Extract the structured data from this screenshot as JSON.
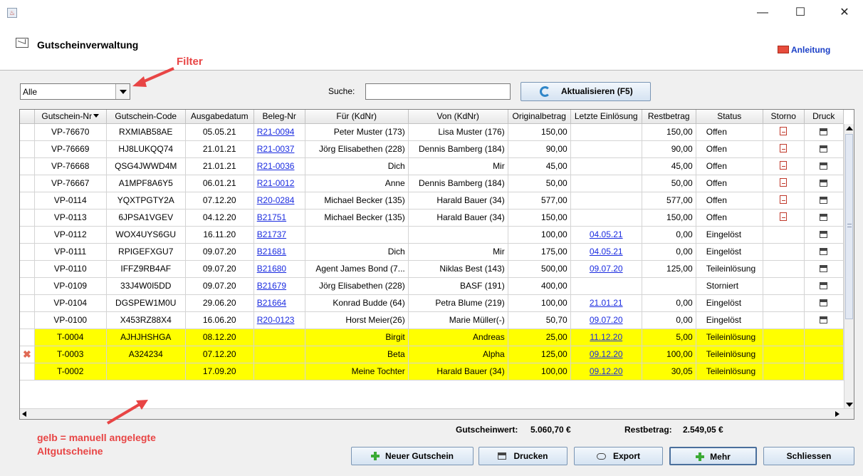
{
  "window": {
    "minimize": "—",
    "maximize": "☐",
    "close": "✕"
  },
  "header": {
    "title": "Gutscheinverwaltung",
    "guide_link": "Anleitung"
  },
  "annotations": {
    "filter": "Filter",
    "yellow_note_1": "gelb = manuell angelegte",
    "yellow_note_2": "Altgutscheine"
  },
  "toolbar": {
    "filter_value": "Alle",
    "search_label": "Suche:",
    "search_value": "",
    "refresh_label": "Aktualisieren (F5)"
  },
  "table": {
    "columns": [
      "Gutschein-Nr",
      "Gutschein-Code",
      "Ausgabedatum",
      "Beleg-Nr",
      "Für (KdNr)",
      "Von (KdNr)",
      "Originalbetrag",
      "Letzte Einlösung",
      "Restbetrag",
      "Status",
      "Storno",
      "Druck"
    ],
    "rows": [
      {
        "nr": "VP-76670",
        "code": "RXMIAB58AE",
        "datum": "05.05.21",
        "beleg": "R21-0094",
        "fuer": "Peter Muster (173)",
        "von": "Lisa Muster (176)",
        "orig": "150,00",
        "einl": "",
        "rest": "150,00",
        "status": "Offen",
        "storno": true,
        "druck": true,
        "manual": false,
        "mark": false
      },
      {
        "nr": "VP-76669",
        "code": "HJ8LUKQQ74",
        "datum": "21.01.21",
        "beleg": "R21-0037",
        "fuer": "Jörg Elisabethen (228)",
        "von": "Dennis Bamberg (184)",
        "orig": "90,00",
        "einl": "",
        "rest": "90,00",
        "status": "Offen",
        "storno": true,
        "druck": true,
        "manual": false,
        "mark": false
      },
      {
        "nr": "VP-76668",
        "code": "QSG4JWWD4M",
        "datum": "21.01.21",
        "beleg": "R21-0036",
        "fuer": "Dich",
        "von": "Mir",
        "orig": "45,00",
        "einl": "",
        "rest": "45,00",
        "status": "Offen",
        "storno": true,
        "druck": true,
        "manual": false,
        "mark": false
      },
      {
        "nr": "VP-76667",
        "code": "A1MPF8A6Y5",
        "datum": "06.01.21",
        "beleg": "R21-0012",
        "fuer": "Anne",
        "von": "Dennis Bamberg (184)",
        "orig": "50,00",
        "einl": "",
        "rest": "50,00",
        "status": "Offen",
        "storno": true,
        "druck": true,
        "manual": false,
        "mark": false
      },
      {
        "nr": "VP-0114",
        "code": "YQXTPGTY2A",
        "datum": "07.12.20",
        "beleg": "R20-0284",
        "fuer": "Michael Becker (135)",
        "von": "Harald Bauer (34)",
        "orig": "577,00",
        "einl": "",
        "rest": "577,00",
        "status": "Offen",
        "storno": true,
        "druck": true,
        "manual": false,
        "mark": false
      },
      {
        "nr": "VP-0113",
        "code": "6JPSA1VGEV",
        "datum": "04.12.20",
        "beleg": "B21751",
        "fuer": "Michael Becker (135)",
        "von": "Harald Bauer (34)",
        "orig": "150,00",
        "einl": "",
        "rest": "150,00",
        "status": "Offen",
        "storno": true,
        "druck": true,
        "manual": false,
        "mark": false
      },
      {
        "nr": "VP-0112",
        "code": "WOX4UYS6GU",
        "datum": "16.11.20",
        "beleg": "B21737",
        "fuer": "",
        "von": "",
        "orig": "100,00",
        "einl": "04.05.21",
        "rest": "0,00",
        "status": "Eingelöst",
        "storno": false,
        "druck": true,
        "manual": false,
        "mark": false
      },
      {
        "nr": "VP-0111",
        "code": "RPIGEFXGU7",
        "datum": "09.07.20",
        "beleg": "B21681",
        "fuer": "Dich",
        "von": "Mir",
        "orig": "175,00",
        "einl": "04.05.21",
        "rest": "0,00",
        "status": "Eingelöst",
        "storno": false,
        "druck": true,
        "manual": false,
        "mark": false
      },
      {
        "nr": "VP-0110",
        "code": "IFFZ9RB4AF",
        "datum": "09.07.20",
        "beleg": "B21680",
        "fuer": "Agent James Bond (7...",
        "von": "Niklas Best (143)",
        "orig": "500,00",
        "einl": "09.07.20",
        "rest": "125,00",
        "status": "Teileinlösung",
        "storno": false,
        "druck": true,
        "manual": false,
        "mark": false
      },
      {
        "nr": "VP-0109",
        "code": "33J4W0I5DD",
        "datum": "09.07.20",
        "beleg": "B21679",
        "fuer": "Jörg Elisabethen (228)",
        "von": "BASF (191)",
        "orig": "400,00",
        "einl": "",
        "rest": "",
        "status": "Storniert",
        "storno": false,
        "druck": true,
        "manual": false,
        "mark": false
      },
      {
        "nr": "VP-0104",
        "code": "DGSPEW1M0U",
        "datum": "29.06.20",
        "beleg": "B21664",
        "fuer": "Konrad Budde (64)",
        "von": "Petra Blume (219)",
        "orig": "100,00",
        "einl": "21.01.21",
        "rest": "0,00",
        "status": "Eingelöst",
        "storno": false,
        "druck": true,
        "manual": false,
        "mark": false
      },
      {
        "nr": "VP-0100",
        "code": "X453RZ88X4",
        "datum": "16.06.20",
        "beleg": "R20-0123",
        "fuer": "Horst Meier(26)",
        "von": "Marie Müller(-)",
        "orig": "50,70",
        "einl": "09.07.20",
        "rest": "0,00",
        "status": "Eingelöst",
        "storno": false,
        "druck": true,
        "manual": false,
        "mark": false
      },
      {
        "nr": "T-0004",
        "code": "AJHJHSHGA",
        "datum": "08.12.20",
        "beleg": "",
        "fuer": "Birgit",
        "von": "Andreas",
        "orig": "25,00",
        "einl": "11.12.20",
        "rest": "5,00",
        "status": "Teileinlösung",
        "storno": false,
        "druck": false,
        "manual": true,
        "mark": false
      },
      {
        "nr": "T-0003",
        "code": "A324234",
        "datum": "07.12.20",
        "beleg": "",
        "fuer": "Beta",
        "von": "Alpha",
        "orig": "125,00",
        "einl": "09.12.20",
        "rest": "100,00",
        "status": "Teileinlösung",
        "storno": false,
        "druck": false,
        "manual": true,
        "mark": true
      },
      {
        "nr": "T-0002",
        "code": "",
        "datum": "17.09.20",
        "beleg": "",
        "fuer": "Meine Tochter",
        "von": "Harald Bauer (34)",
        "orig": "100,00",
        "einl": "09.12.20",
        "rest": "30,05",
        "status": "Teileinlösung",
        "storno": false,
        "druck": false,
        "manual": true,
        "mark": false
      }
    ]
  },
  "totals": {
    "wert_label": "Gutscheinwert:",
    "wert_value": "5.060,70 €",
    "rest_label": "Restbetrag:",
    "rest_value": "2.549,05 €"
  },
  "buttons": {
    "new": "Neuer Gutschein",
    "print": "Drucken",
    "export": "Export",
    "more": "Mehr",
    "close": "Schliessen"
  },
  "colors": {
    "manual_row": "#ffff00",
    "annotation": "#e84545",
    "link": "#1b2ce0"
  }
}
